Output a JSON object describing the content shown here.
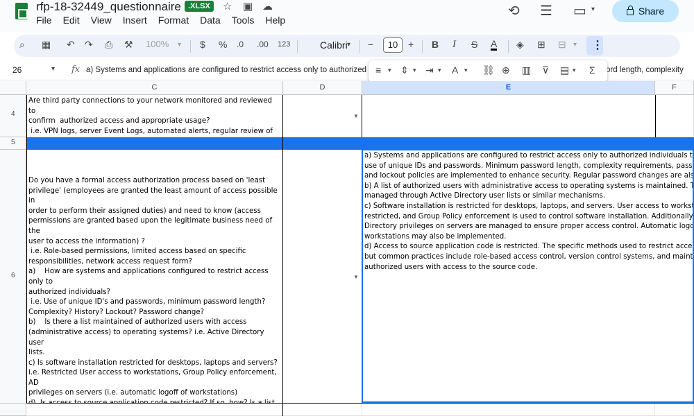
{
  "header": {
    "doc_title": "rfp-18-32449_questionnaire",
    "file_badge": ".XLSX",
    "share_label": "Share",
    "menu": [
      "File",
      "Edit",
      "View",
      "Insert",
      "Format",
      "Data",
      "Tools",
      "Help"
    ]
  },
  "toolbar": {
    "zoom": "100%",
    "currency": "$",
    "percent": "%",
    "dec_decrease": ".0",
    "dec_increase": ".00",
    "number_format": "123",
    "font": "Calibri",
    "font_size": "10",
    "bold": "B",
    "italic": "I",
    "strike": "S",
    "text_color": "A"
  },
  "formula_bar": {
    "name_box": "26",
    "fx": "fx",
    "formula_text": "a) Systems and applications are configured to restrict access only to authorized individuals through the",
    "formula_right": "ord length, complexity"
  },
  "grid": {
    "columns": [
      "C",
      "D",
      "E",
      "F"
    ],
    "rows": [
      {
        "label": "4",
        "c": "Are third party connections to your network monitored and reviewed to\nconfirm  authorized access and appropriate usage?\n i.e. VPN logs, server Event Logs, automated alerts, regular review of logs\nor reports."
      },
      {
        "label": "5"
      },
      {
        "label": "6",
        "c": "Do you have a formal access authorization process based on 'least\nprivilege' (employees are granted the least amount of access possible in\norder to perform their assigned duties) and need to know (access\npermissions are granted based upon the legitimate business need of the\nuser to access the information) ?\n i.e. Role-based permissions, limited access based on specific\nresponsibilities, network access request form?\na)    How are systems and applications configured to restrict access only to\nauthorized individuals?\n i.e. Use of unique ID's and passwords, minimum password length?\nComplexity? History? Lockout? Password change?\nb)    Is there a list maintained of authorized users with access\n(administrative access) to operating systems? i.e. Active Directory user\nlists.\nc) Is software installation restricted for desktops, laptops and servers?\ni.e. Restricted User access to workstations, Group Policy enforcement, AD\nprivileges on servers (i.e. automatic logoff of workstations)\nd)  Is access to source application code restricted? If so, how? Is a list of\nauthorized users maintained?",
        "e": "a) Systems and applications are configured to restrict access only to authorized individuals through the\nuse of unique IDs and passwords. Minimum password length, complexity requirements, password history,\nand lockout policies are implemented to enhance security. Regular password changes are also enforced.\nb) A list of authorized users with administrative access to operating systems is maintained. This is\nmanaged through Active Directory user lists or similar mechanisms.\nc) Software installation is restricted for desktops, laptops, and servers. User access to workstations is\nrestricted, and Group Policy enforcement is used to control software installation. Additionally, AD\nDirectory privileges on servers are managed to ensure proper access control. Automatic logoff of\nworkstations may also be implemented.\nd) Access to source application code is restricted. The specific methods used to restrict access may vary,\nbut common practices include role-based access control, version control systems, and maintaining\nauthorized users with access to the source code."
      }
    ]
  },
  "colors": {
    "accent": "#1a73e8",
    "share_bg": "#c2e7ff",
    "sheets_green": "#188038"
  }
}
